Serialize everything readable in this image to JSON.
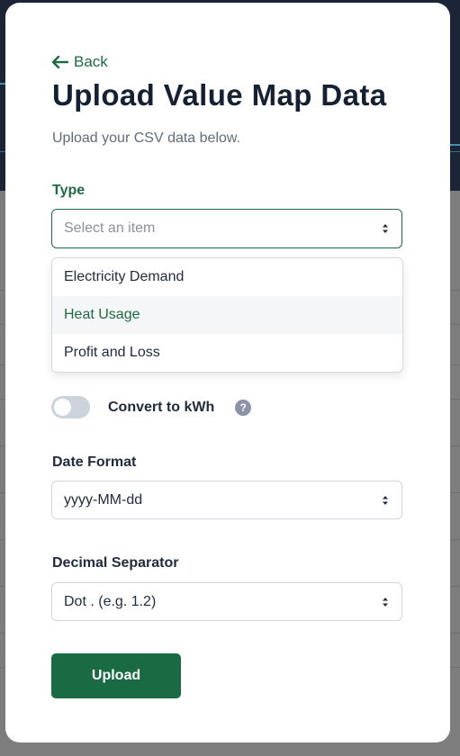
{
  "modal": {
    "back_label": "Back",
    "title": "Upload Value Map Data",
    "subtitle": "Upload your CSV data below."
  },
  "type_field": {
    "label": "Type",
    "placeholder": "Select an item",
    "options": [
      "Electricity Demand",
      "Heat Usage",
      "Profit and Loss"
    ],
    "highlighted_option": "Heat Usage"
  },
  "convert_toggle": {
    "label": "Convert to kWh",
    "on": false,
    "help_glyph": "?"
  },
  "date_format_field": {
    "label": "Date Format",
    "value": "yyyy-MM-dd"
  },
  "decimal_separator_field": {
    "label": "Decimal Separator",
    "value": "Dot . (e.g. 1.2)"
  },
  "upload_button": {
    "label": "Upload"
  },
  "colors": {
    "primary_green": "#1a6a44",
    "title_dark": "#152033",
    "toggle_off": "#cbd3dc"
  },
  "icons": {
    "back": "arrow-left-icon",
    "select_caret": "updown-caret-icon",
    "help": "question-circle-icon"
  }
}
